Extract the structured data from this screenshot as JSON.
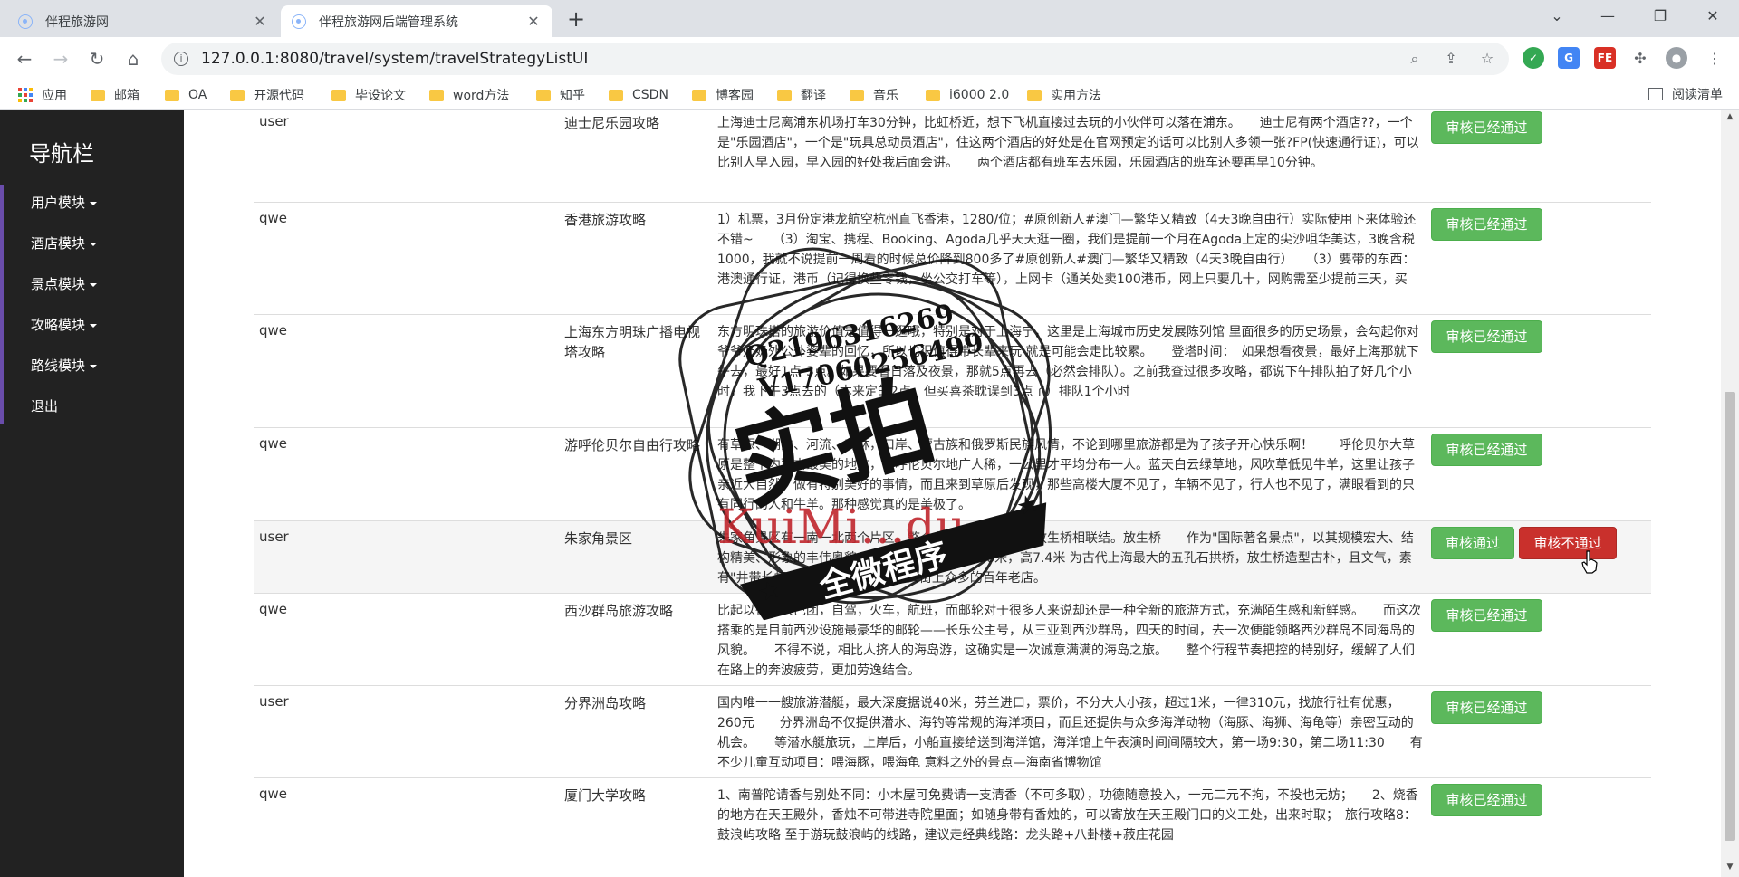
{
  "browser": {
    "tabs": [
      {
        "title": "伴程旅游网",
        "active": false
      },
      {
        "title": "伴程旅游网后端管理系统",
        "active": true
      }
    ],
    "url": "127.0.0.1:8080/travel/system/travelStrategyListUI",
    "bookmarks": [
      "应用",
      "邮箱",
      "OA",
      "开源代码",
      "毕设论文",
      "word方法",
      "知乎",
      "CSDN",
      "博客园",
      "翻译",
      "音乐",
      "i6000 2.0",
      "实用方法"
    ],
    "reading_list": "阅读清单"
  },
  "sidebar": {
    "title": "导航栏",
    "items": [
      "用户模块",
      "酒店模块",
      "景点模块",
      "攻略模块",
      "路线模块",
      "退出"
    ]
  },
  "table": {
    "rows": [
      {
        "user": "user",
        "title": "迪士尼乐园攻略",
        "content": "上海迪士尼离浦东机场打车30分钟，比虹桥近，想下飞机直接过去玩的小伙伴可以落在浦东。　　迪士尼有两个酒店??，一个是\"乐园酒店\"，一个是\"玩具总动员酒店\"，住这两个酒店的好处是在官网预定的话可以比别人多领一张?FP(快速通行证)，可以比别人早入园，早入园的好处我后面会讲。　　两个酒店都有班车去乐园，乐园酒店的班车还要再早10分钟。",
        "buttons": [
          "审核已经通过"
        ]
      },
      {
        "user": "qwe",
        "title": "香港旅游攻略",
        "content": "1）机票，3月份定港龙航空杭州直飞香港，1280/位；#原创新人#澳门—繁华又精致（4天3晚自由行）实际使用下来体验还不错~　　（3）淘宝、携程、Booking、Agoda几乎天天逛一圈，我们是提前一个月在Agoda上定的尖沙咀华美达，3晚含税1000，我就不说提前一周看的时候总价降到800多了#原创新人#澳门—繁华又精致（4天3晚自由行）　　（3）要带的东西：港澳通行证，港币（记得换些零钱，坐公交打车等），上网卡（通关处卖100港币，网上只要几十，网购需至少提前三天，买",
        "buttons": [
          "审核已经通过"
        ]
      },
      {
        "user": "qwe",
        "title": "上海东方明珠广播电视塔攻略",
        "content": "东方明珠塔的旅游价值是值得一逛哦，特别是对于上海宁，这里是上海城市历史发展陈列馆 里面很多的历史场景，会勾起你对爷爷奶奶外公外婆辈的回忆，所以也很值得带长辈来玩 就是可能会走比较累。　　登塔时间：　如果想看夜景，最好上海那就下午去，最好1点-3点。如果要看日落及夜景，那就5点再去（必然会排队）。之前我查过很多攻略，都说下午排队拍了好几个小时，我下午3点去的（本来定的2点，但买喜茶耽误到3点了）排队1个小时",
        "buttons": [
          "审核已经通过"
        ]
      },
      {
        "user": "qwe",
        "title": "游呼伦贝尔自由行攻略",
        "content": "有草原、湖泊、河流、森林，口岸、蒙古族和俄罗斯民族风情，不论到哪里旅游都是为了孩子开心快乐啊！　　呼伦贝尔大草原是整个内蒙古最美的地方，有呼伦贝尔地广人稀，一公里才平均分布一人。蓝天白云绿草地，风吹草低见牛羊，这里让孩子亲近大自然，做有特别美好的事情，而且来到草原后发现，那些高楼大厦不见了，车辆不见了，行人也不见了，满眼看到的只有同行的人和牛羊。那种感觉真的是美极了。",
        "buttons": [
          "审核已经通过"
        ]
      },
      {
        "user": "user",
        "title": "朱家角景区",
        "content": "朱家角景区有一南一北两个片区，整个北片区域，当中以放生桥相联结。放生桥　　作为\"国际著名景点\"，以其规模宏大、结构精美、形象的丰伟奥貌，全桥总长72米，宽5.8米，高7.4米 为古代上海最大的五孔石拱桥，放生桥造型古朴，且文气，素有\"井带长虹\"的美称，串起桥畔北大街上众多的百年老店。",
        "buttons": [
          "审核通过",
          "审核不通过"
        ]
      },
      {
        "user": "qwe",
        "title": "西沙群岛旅游攻略",
        "content": "比起以往的大巴团，自驾，火车，航班，而邮轮对于很多人来说却还是一种全新的旅游方式，充满陌生感和新鲜感。　　而这次搭乘的是目前西沙设施最豪华的邮轮——长乐公主号，从三亚到西沙群岛，四天的时间，去一次便能领略西沙群岛不同海岛的风貌。　　不得不说，相比人挤人的海岛游，这确实是一次诚意满满的海岛之旅。　　整个行程节奏把控的特别好，缓解了人们在路上的奔波疲劳，更加劳逸结合。",
        "buttons": [
          "审核已经通过"
        ]
      },
      {
        "user": "user",
        "title": "分界洲岛攻略",
        "content": "国内唯一一艘旅游潜艇，最大深度据说40米，芬兰进口，票价，不分大人小孩，超过1米，一律310元，找旅行社有优惠，260元　　分界洲岛不仅提供潜水、海钓等常规的海洋项目，而且还提供与众多海洋动物（海豚、海狮、海龟等）亲密互动的机会。　　等潜水艇旅玩，上岸后，小船直接给送到海洋馆，海洋馆上午表演时间间隔较大，第一场9:30，第二场11:30　　有不少儿童互动项目：喂海豚，喂海龟 意料之外的景点—海南省博物馆",
        "buttons": [
          "审核已经通过"
        ]
      },
      {
        "user": "qwe",
        "title": "厦门大学攻略",
        "content": "1、南普陀请香与别处不同：小木屋可免费请一支清香（不可多取），功德随意投入，一元二元不拘，不投也无妨；　　2、烧香的地方在天王殿外，香烛不可带进寺院里面；如随身带有香烛的，可以寄放在天王殿门口的义工处，出来时取；　旅行攻略8：　鼓浪屿攻略 至于游玩鼓浪屿的线路，建议走经典线路：龙头路+八卦楼+菽庄花园",
        "buttons": [
          "审核已经通过"
        ]
      }
    ]
  },
  "watermark": {
    "line1": "Q2196316269",
    "line2": "V17060256499",
    "main": "实拍",
    "brand": "KuiMi...du",
    "banner": "全微程序"
  },
  "colors": {
    "sidebar_bg": "#222222",
    "sidebar_accent": "#6a4dab",
    "btn_success": "#5cb85c",
    "btn_danger": "#c9302c"
  }
}
